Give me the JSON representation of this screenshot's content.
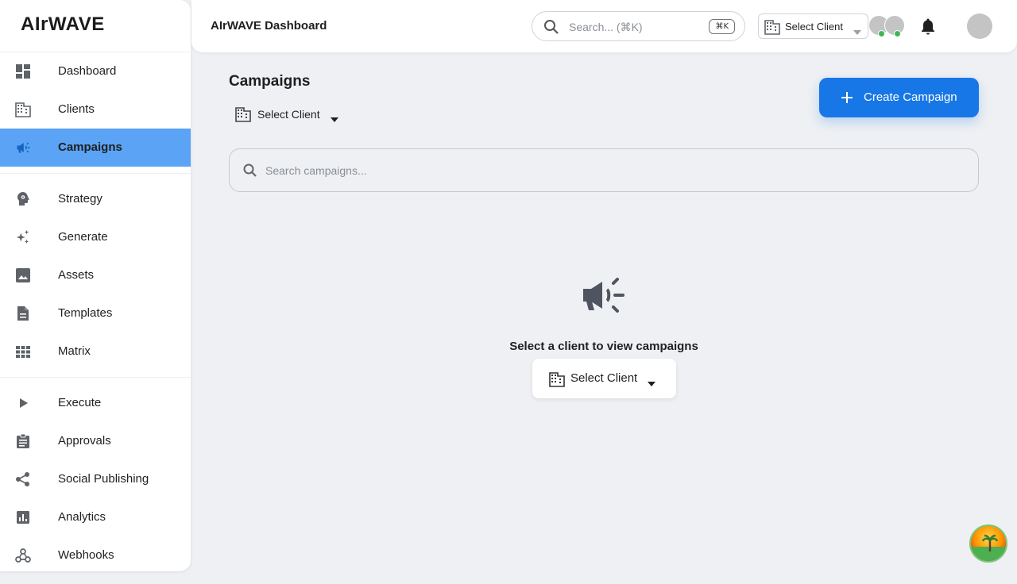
{
  "app": {
    "brand": "AIrWAVE"
  },
  "topbar": {
    "title": "AIrWAVE Dashboard",
    "search_placeholder": "Search... (⌘K)",
    "search_shortcut": "⌘K",
    "client_select_label": "Select Client"
  },
  "sidebar": {
    "items": [
      {
        "label": "Dashboard",
        "icon": "dashboard-icon"
      },
      {
        "label": "Clients",
        "icon": "building-icon"
      },
      {
        "label": "Campaigns",
        "icon": "megaphone-icon",
        "active": true
      },
      {
        "label": "Strategy",
        "icon": "brain-head-icon"
      },
      {
        "label": "Generate",
        "icon": "sparkles-icon"
      },
      {
        "label": "Assets",
        "icon": "image-icon"
      },
      {
        "label": "Templates",
        "icon": "document-icon"
      },
      {
        "label": "Matrix",
        "icon": "grid-icon"
      },
      {
        "label": "Execute",
        "icon": "play-icon"
      },
      {
        "label": "Approvals",
        "icon": "clipboard-icon"
      },
      {
        "label": "Social Publishing",
        "icon": "share-icon"
      },
      {
        "label": "Analytics",
        "icon": "analytics-icon"
      },
      {
        "label": "Webhooks",
        "icon": "webhook-icon"
      }
    ]
  },
  "main": {
    "page_title": "Campaigns",
    "client_filter_label": "Select Client",
    "create_button_label": "Create Campaign",
    "search_placeholder": "Search campaigns...",
    "empty_state": {
      "message": "Select a client to view campaigns",
      "select_label": "Select Client"
    }
  },
  "colors": {
    "accent": "#1877e6",
    "active_nav": "#5aa3f5",
    "online": "#43b453",
    "background": "#eef0f3"
  }
}
